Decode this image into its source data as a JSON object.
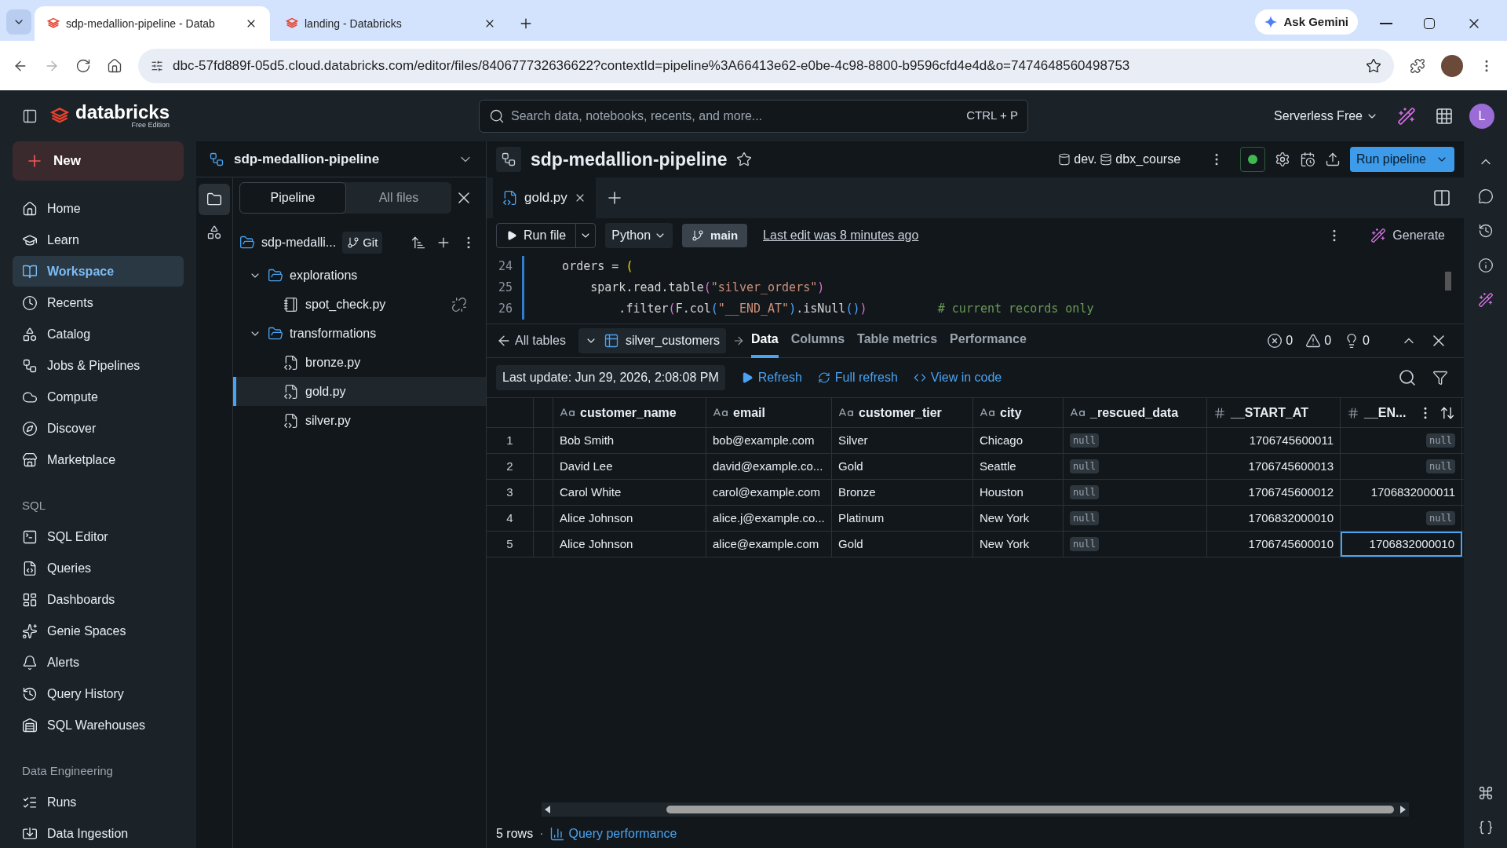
{
  "browser": {
    "tabs": [
      {
        "title": "sdp-medallion-pipeline - Datab",
        "selected": true
      },
      {
        "title": "landing - Databricks",
        "selected": false
      }
    ],
    "ask": "Ask Gemini",
    "url": "dbc-57fd889f-05d5.cloud.databricks.com/editor/files/840677732636622?contextId=pipeline%3A66413e62-e0be-4c98-8800-b9596cfd4e4d&o=7474648560498753"
  },
  "topbar": {
    "logo": "databricks",
    "logo_sub": "Free Edition",
    "search": {
      "placeholder": "Search data, notebooks, recents, and more...",
      "shortcut": "CTRL + P"
    },
    "compute": "Serverless Free",
    "avatar": "L"
  },
  "sidebar": {
    "new": "New",
    "sections": [
      {
        "items": [
          {
            "label": "Home",
            "selected": false
          },
          {
            "label": "Learn",
            "selected": false
          },
          {
            "label": "Workspace",
            "selected": true
          },
          {
            "label": "Recents",
            "selected": false
          },
          {
            "label": "Catalog",
            "selected": false
          },
          {
            "label": "Jobs & Pipelines",
            "selected": false
          },
          {
            "label": "Compute",
            "selected": false
          },
          {
            "label": "Discover",
            "selected": false
          },
          {
            "label": "Marketplace",
            "selected": false
          }
        ]
      },
      {
        "heading": "SQL",
        "items": [
          {
            "label": "SQL Editor",
            "selected": false
          },
          {
            "label": "Queries",
            "selected": false
          },
          {
            "label": "Dashboards",
            "selected": false
          },
          {
            "label": "Genie Spaces",
            "selected": false
          },
          {
            "label": "Alerts",
            "selected": false
          },
          {
            "label": "Query History",
            "selected": false
          },
          {
            "label": "SQL Warehouses",
            "selected": false
          }
        ]
      },
      {
        "heading": "Data Engineering",
        "items": [
          {
            "label": "Runs",
            "selected": false
          },
          {
            "label": "Data Ingestion",
            "selected": false
          }
        ]
      }
    ]
  },
  "file_panel": {
    "title": "sdp-medallion-pipeline",
    "tabs": [
      {
        "label": "Pipeline",
        "selected": true
      },
      {
        "label": "All files",
        "selected": false
      }
    ],
    "root": {
      "label": "sdp-medalli...",
      "badge": "Git"
    },
    "tree": [
      {
        "label": "explorations",
        "kind": "folder",
        "expanded": true,
        "selected": false,
        "children": [
          {
            "label": "spot_check.py",
            "kind": "notebook",
            "selected": false
          }
        ]
      },
      {
        "label": "transformations",
        "kind": "folder",
        "expanded": true,
        "selected": false,
        "children": [
          {
            "label": "bronze.py",
            "kind": "file",
            "selected": false
          },
          {
            "label": "gold.py",
            "kind": "file",
            "selected": true
          },
          {
            "label": "silver.py",
            "kind": "file",
            "selected": false
          }
        ]
      }
    ]
  },
  "editor": {
    "title": "sdp-medallion-pipeline",
    "catalog": "dev.",
    "schema": "dbx_course",
    "run_button": "Run pipeline",
    "file_tabs": [
      {
        "label": "gold.py",
        "selected": true
      }
    ],
    "toolbar": {
      "run": "Run file",
      "language": "Python",
      "branch": "main",
      "last_edit": "Last edit was 8 minutes ago",
      "generate": "Generate"
    },
    "code": [
      {
        "number": "24",
        "segments": [
          {
            "text": "    orders = ",
            "kind": "plain"
          },
          {
            "text": "(",
            "kind": "paren1"
          }
        ]
      },
      {
        "number": "25",
        "segments": [
          {
            "text": "        spark.read.table",
            "kind": "plain"
          },
          {
            "text": "(",
            "kind": "paren2"
          },
          {
            "text": "\"silver_orders\"",
            "kind": "string"
          },
          {
            "text": ")",
            "kind": "paren2"
          }
        ]
      },
      {
        "number": "26",
        "segments": [
          {
            "text": "            .filter",
            "kind": "plain"
          },
          {
            "text": "(",
            "kind": "paren2"
          },
          {
            "text": "F.col",
            "kind": "plain"
          },
          {
            "text": "(",
            "kind": "paren3"
          },
          {
            "text": "\"__END_AT\"",
            "kind": "string"
          },
          {
            "text": ")",
            "kind": "paren3"
          },
          {
            "text": ".isNull",
            "kind": "plain"
          },
          {
            "text": "()",
            "kind": "paren3"
          },
          {
            "text": ")",
            "kind": "paren2"
          },
          {
            "text": "          # current records only",
            "kind": "comment"
          }
        ]
      }
    ]
  },
  "results": {
    "back": "All tables",
    "table": "silver_customers",
    "tabs": [
      {
        "label": "Data",
        "selected": true
      },
      {
        "label": "Columns",
        "selected": false
      },
      {
        "label": "Table metrics",
        "selected": false
      },
      {
        "label": "Performance",
        "selected": false
      }
    ],
    "errors": "0",
    "warnings": "0",
    "hints": "0",
    "last_update": "Last update: Jun 29, 2026, 2:08:08 PM",
    "actions": [
      "Refresh",
      "Full refresh",
      "View in code"
    ],
    "columns": [
      {
        "name": "customer_name",
        "kind": "string"
      },
      {
        "name": "email",
        "kind": "string"
      },
      {
        "name": "customer_tier",
        "kind": "string"
      },
      {
        "name": "city",
        "kind": "string"
      },
      {
        "name": "_rescued_data",
        "kind": "string"
      },
      {
        "name": "__START_AT",
        "kind": "number"
      },
      {
        "name": "__EN...",
        "kind": "number"
      }
    ],
    "rows": [
      {
        "number": "1",
        "cells": [
          {
            "text": "Bob Smith",
            "kind": "value",
            "selected": false
          },
          {
            "text": "bob@example.com",
            "kind": "value",
            "selected": false
          },
          {
            "text": "Silver",
            "kind": "value",
            "selected": false
          },
          {
            "text": "Chicago",
            "kind": "value",
            "selected": false
          },
          {
            "text": "null",
            "kind": "null",
            "selected": false
          },
          {
            "text": "1706745600011",
            "kind": "value",
            "selected": false
          },
          {
            "text": "null",
            "kind": "null",
            "selected": false
          }
        ]
      },
      {
        "number": "2",
        "cells": [
          {
            "text": "David Lee",
            "kind": "value",
            "selected": false
          },
          {
            "text": "david@example.co...",
            "kind": "value",
            "selected": false
          },
          {
            "text": "Gold",
            "kind": "value",
            "selected": false
          },
          {
            "text": "Seattle",
            "kind": "value",
            "selected": false
          },
          {
            "text": "null",
            "kind": "null",
            "selected": false
          },
          {
            "text": "1706745600013",
            "kind": "value",
            "selected": false
          },
          {
            "text": "null",
            "kind": "null",
            "selected": false
          }
        ]
      },
      {
        "number": "3",
        "cells": [
          {
            "text": "Carol White",
            "kind": "value",
            "selected": false
          },
          {
            "text": "carol@example.com",
            "kind": "value",
            "selected": false
          },
          {
            "text": "Bronze",
            "kind": "value",
            "selected": false
          },
          {
            "text": "Houston",
            "kind": "value",
            "selected": false
          },
          {
            "text": "null",
            "kind": "null",
            "selected": false
          },
          {
            "text": "1706745600012",
            "kind": "value",
            "selected": false
          },
          {
            "text": "1706832000011",
            "kind": "value",
            "selected": false
          }
        ]
      },
      {
        "number": "4",
        "cells": [
          {
            "text": "Alice Johnson",
            "kind": "value",
            "selected": false
          },
          {
            "text": "alice.j@example.co...",
            "kind": "value",
            "selected": false
          },
          {
            "text": "Platinum",
            "kind": "value",
            "selected": false
          },
          {
            "text": "New York",
            "kind": "value",
            "selected": false
          },
          {
            "text": "null",
            "kind": "null",
            "selected": false
          },
          {
            "text": "1706832000010",
            "kind": "value",
            "selected": false
          },
          {
            "text": "null",
            "kind": "null",
            "selected": false
          }
        ]
      },
      {
        "number": "5",
        "cells": [
          {
            "text": "Alice Johnson",
            "kind": "value",
            "selected": false
          },
          {
            "text": "alice@example.com",
            "kind": "value",
            "selected": false
          },
          {
            "text": "Gold",
            "kind": "value",
            "selected": false
          },
          {
            "text": "New York",
            "kind": "value",
            "selected": false
          },
          {
            "text": "null",
            "kind": "null",
            "selected": false
          },
          {
            "text": "1706745600010",
            "kind": "value",
            "selected": false
          },
          {
            "text": "1706832000010",
            "kind": "value",
            "selected": true
          }
        ]
      }
    ],
    "row_count": "5 rows",
    "separator": "·",
    "query_performance": "Query performance"
  }
}
